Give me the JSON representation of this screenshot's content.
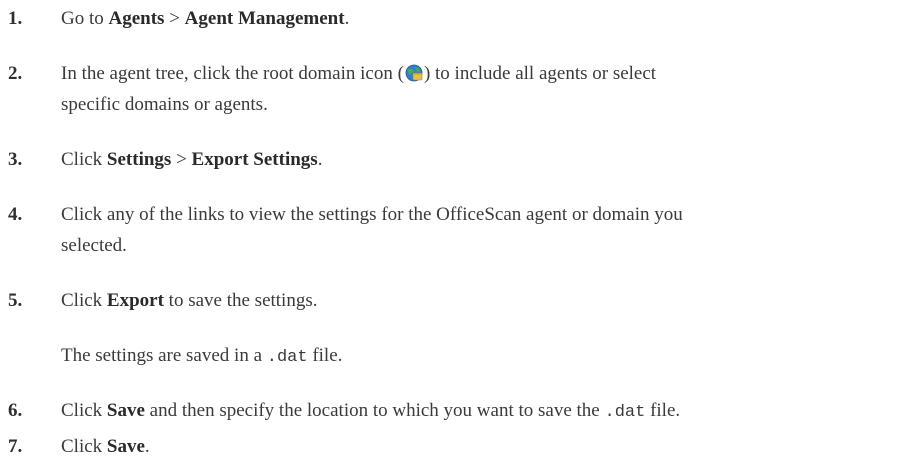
{
  "steps": [
    {
      "num": "1.",
      "parts": [
        "Go to ",
        "Agents",
        " > ",
        "Agent Management",
        "."
      ]
    },
    {
      "num": "2.",
      "line1_a": "In the agent tree, click the root domain icon (",
      "icon": "root-domain-globe-icon",
      "line1_b": ") to include all agents or select",
      "line2": "specific domains or agents."
    },
    {
      "num": "3.",
      "parts": [
        "Click ",
        "Settings",
        " > ",
        "Export Settings",
        "."
      ]
    },
    {
      "num": "4.",
      "line1": "Click any of the links to view the settings for the OfficeScan agent or domain you",
      "line2": "selected."
    },
    {
      "num": "5.",
      "parts": [
        "Click ",
        "Export",
        " to save the settings."
      ]
    },
    {
      "note": [
        "The settings are saved in a ",
        ".dat",
        " file."
      ]
    },
    {
      "num": "6.",
      "parts": [
        "Click ",
        "Save",
        " and then specify the location to which you want to save the ",
        ".dat",
        " file."
      ]
    },
    {
      "num": "7.",
      "parts": [
        "Click ",
        "Save",
        "."
      ]
    }
  ],
  "colors": {
    "text": "#3a3a3a",
    "globe_blue": "#2f7fd0",
    "globe_green": "#4caf3a",
    "globe_yellow": "#e8c24a"
  }
}
